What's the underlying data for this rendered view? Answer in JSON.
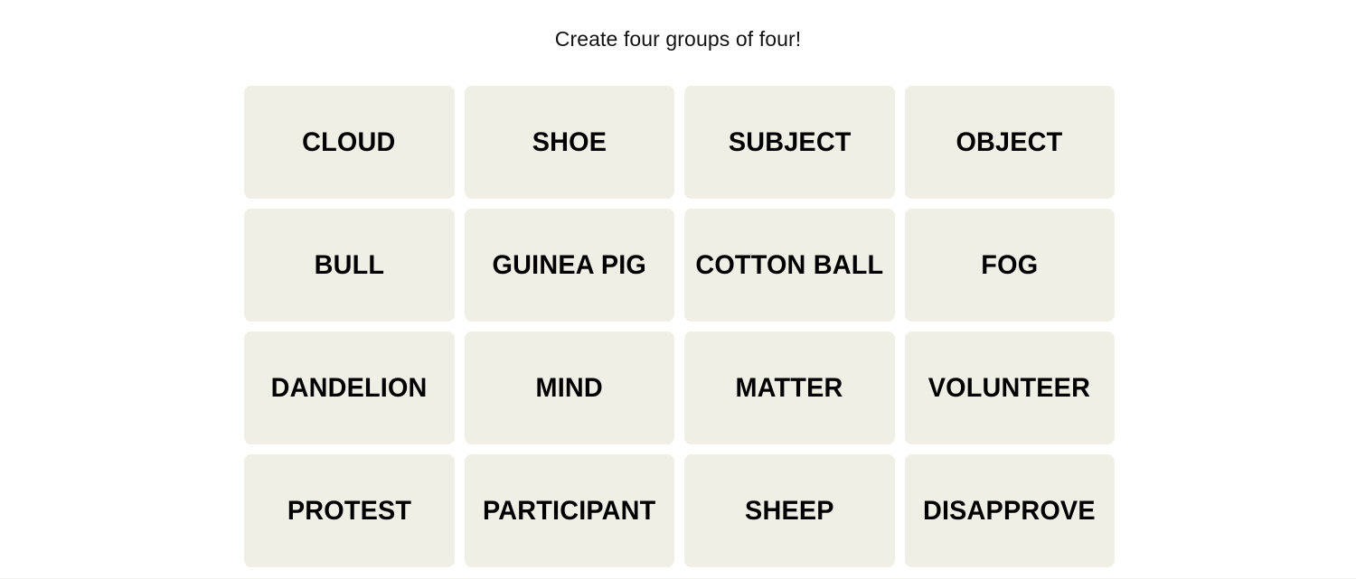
{
  "page": {
    "background_color": "#ffffff",
    "title": "Create four groups of four!"
  },
  "theme": {
    "tile_background": "#efefe6",
    "tile_text_color": "#000000",
    "title_text_color": "#121212"
  },
  "grid": {
    "columns": 4,
    "rows": 4,
    "tiles": [
      {
        "label": "CLOUD"
      },
      {
        "label": "SHOE"
      },
      {
        "label": "SUBJECT"
      },
      {
        "label": "OBJECT"
      },
      {
        "label": "BULL"
      },
      {
        "label": "GUINEA PIG"
      },
      {
        "label": "COTTON BALL"
      },
      {
        "label": "FOG"
      },
      {
        "label": "DANDELION"
      },
      {
        "label": "MIND"
      },
      {
        "label": "MATTER"
      },
      {
        "label": "VOLUNTEER"
      },
      {
        "label": "PROTEST"
      },
      {
        "label": "PARTICIPANT"
      },
      {
        "label": "SHEEP"
      },
      {
        "label": "DISAPPROVE"
      }
    ]
  }
}
